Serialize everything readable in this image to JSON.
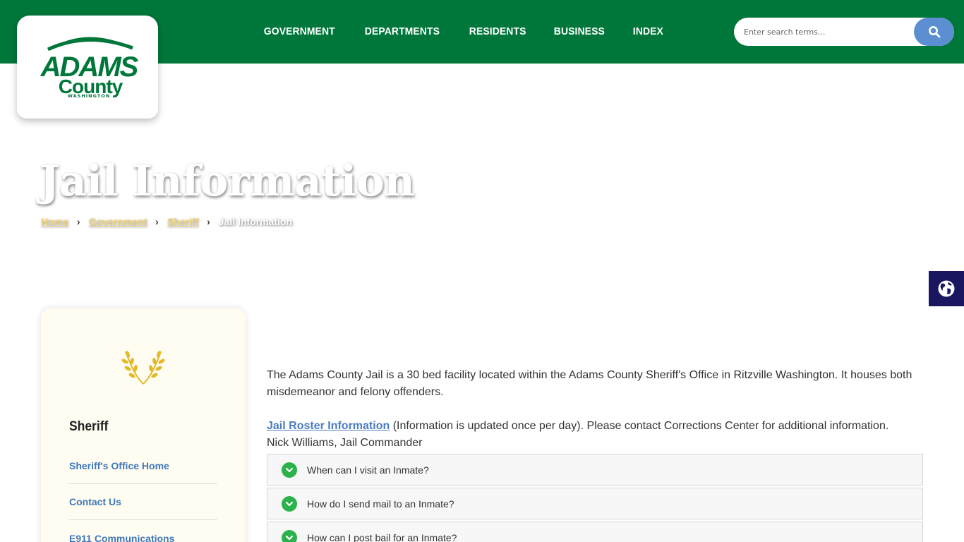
{
  "header": {
    "logo": {
      "line1": "ADAMS",
      "line2": "County",
      "line3": "WASHINGTON",
      "brand_color": "#00773a"
    },
    "nav": [
      {
        "label": "GOVERNMENT"
      },
      {
        "label": "DEPARTMENTS"
      },
      {
        "label": "RESIDENTS"
      },
      {
        "label": "BUSINESS"
      },
      {
        "label": "INDEX"
      }
    ],
    "search": {
      "placeholder": "Enter search terms...",
      "icon": "search-icon",
      "button_color": "#5b8fd1"
    }
  },
  "page": {
    "title": "Jail Information",
    "breadcrumb": {
      "items": [
        "Home",
        "Government",
        "Sheriff"
      ],
      "current": "Jail Information",
      "separator": "›"
    }
  },
  "translate": {
    "icon": "globe-icon",
    "color": "#1a1660"
  },
  "sidebar": {
    "title": "Sheriff",
    "emblem_icon": "wheat-laurel-icon",
    "links": [
      {
        "label": "Sheriff's Office Home"
      },
      {
        "label": "Contact Us"
      },
      {
        "label": "E911 Communications"
      }
    ]
  },
  "content": {
    "intro": "The  Adams County Jail is a 30 bed facility located within the Adams County Sheriff's Office in Ritzville Washington. It houses both misdemeanor and felony offenders.",
    "roster_link": "Jail Roster Information",
    "roster_note": " (Information is updated once per day). Please contact Corrections Center for additional information.",
    "commander": "Nick Williams, Jail Commander"
  },
  "faq": [
    {
      "question": "When can I visit an Inmate?",
      "icon": "chevron-down-icon"
    },
    {
      "question": "How do I send mail to an Inmate?",
      "icon": "chevron-down-icon"
    },
    {
      "question": "How can I post bail for an Inmate?",
      "icon": "chevron-down-icon"
    }
  ],
  "colors": {
    "header_green": "#00773a",
    "link_blue": "#3f78b9",
    "breadcrumb_gold": "#f0d37a",
    "accordion_green": "#2bb24c"
  }
}
